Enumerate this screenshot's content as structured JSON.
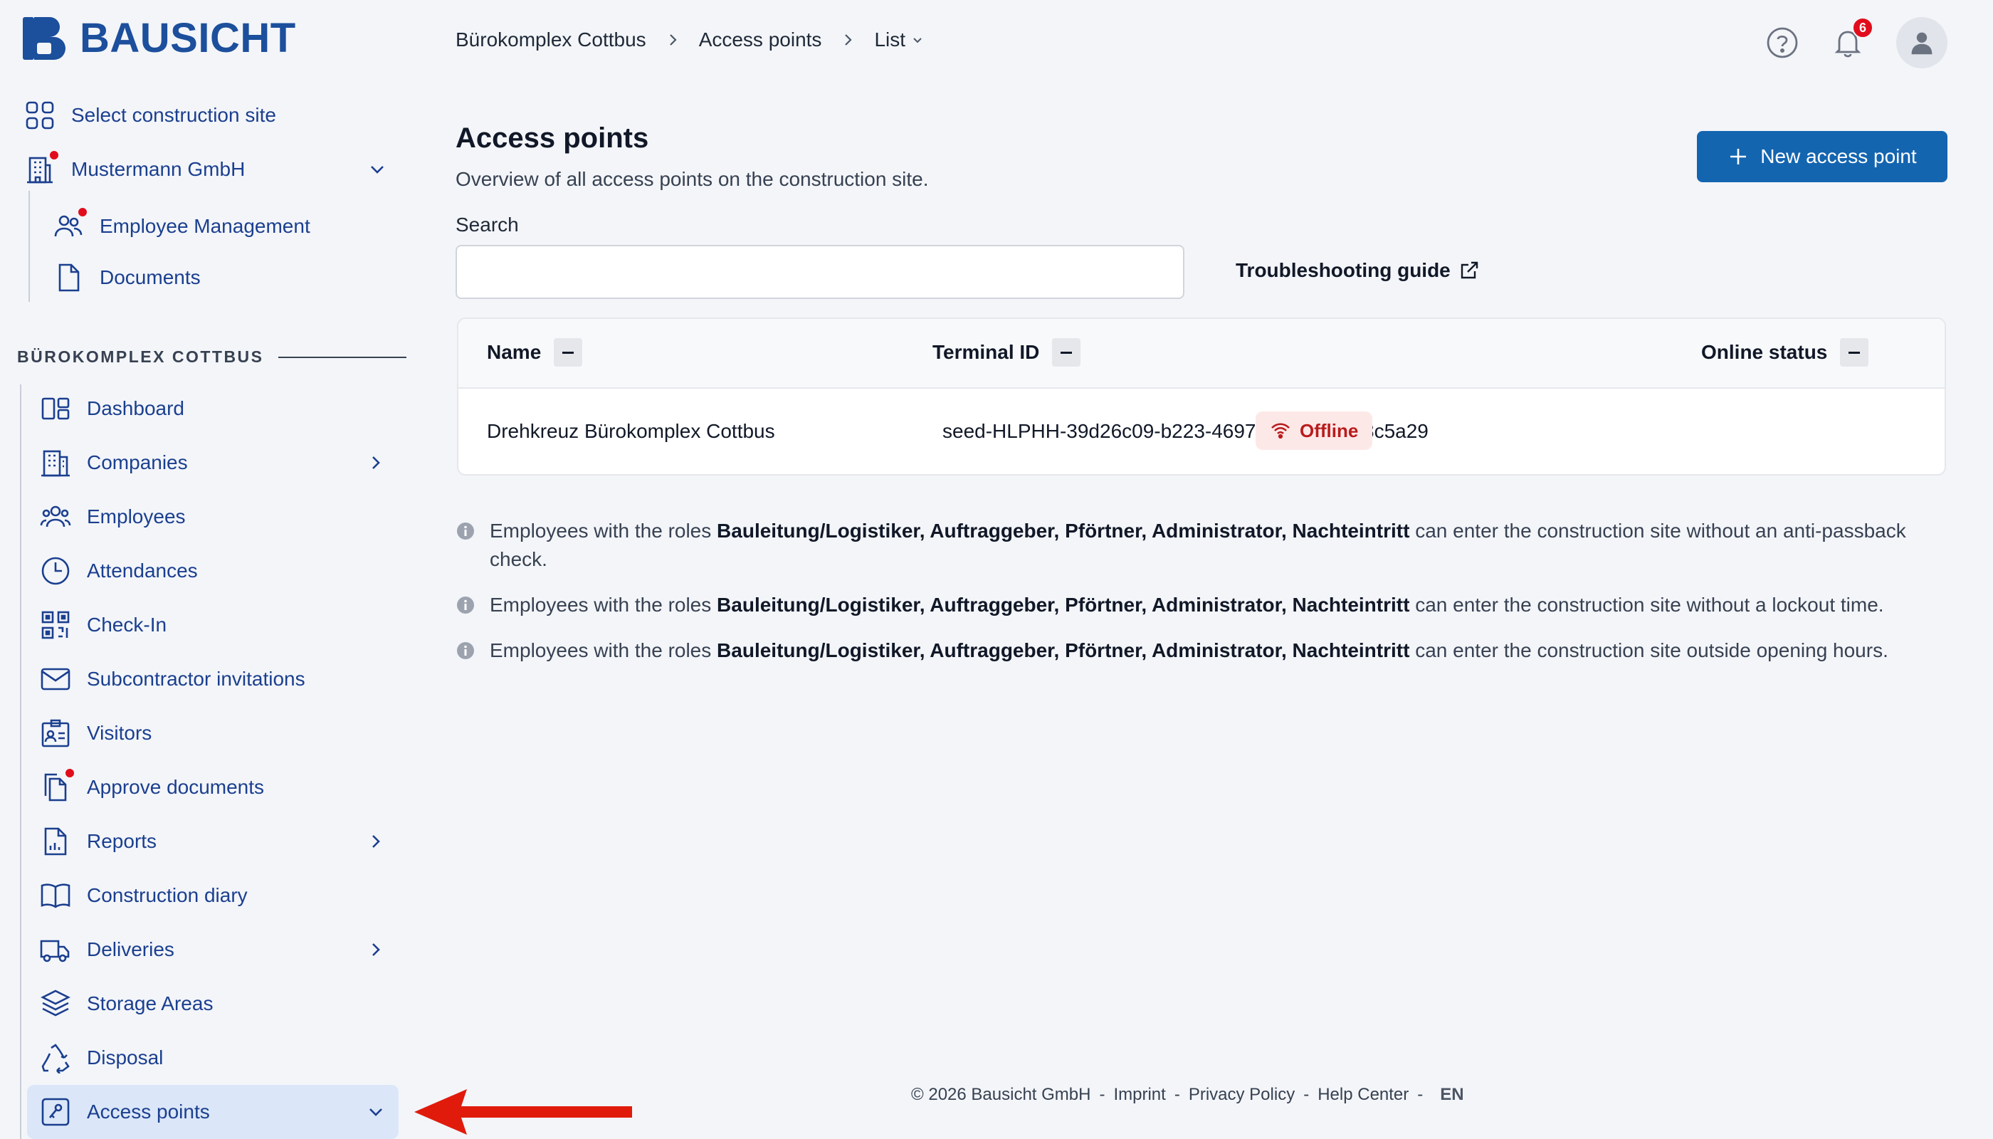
{
  "brand": {
    "name": "BAUSICHT",
    "color": "#1c4f9c"
  },
  "colors": {
    "primary": "#1465b0",
    "nav_text": "#1b3f8f",
    "alert_dot": "#e10d1c",
    "offline_bg": "#fde8e8",
    "offline_text": "#b91c1c",
    "arrow": "#e01b0c"
  },
  "sidebar": {
    "select_site": "Select construction site",
    "company": "Mustermann GmbH",
    "company_items": [
      "Employee Management",
      "Documents"
    ],
    "section_title": "BÜROKOMPLEX COTTBUS",
    "items": [
      {
        "label": "Dashboard",
        "icon": "dashboard-icon"
      },
      {
        "label": "Companies",
        "icon": "building-icon"
      },
      {
        "label": "Employees",
        "icon": "users-icon"
      },
      {
        "label": "Attendances",
        "icon": "clock-icon"
      },
      {
        "label": "Check-In",
        "icon": "qr-code-icon"
      },
      {
        "label": "Subcontractor invitations",
        "icon": "envelope-icon"
      },
      {
        "label": "Visitors",
        "icon": "id-card-icon"
      },
      {
        "label": "Approve documents",
        "icon": "documents-icon"
      },
      {
        "label": "Reports",
        "icon": "report-icon"
      },
      {
        "label": "Construction diary",
        "icon": "book-icon"
      },
      {
        "label": "Deliveries",
        "icon": "truck-icon"
      },
      {
        "label": "Storage Areas",
        "icon": "layers-icon"
      },
      {
        "label": "Disposal",
        "icon": "recycle-icon"
      },
      {
        "label": "Access points",
        "icon": "access-point-icon"
      }
    ]
  },
  "header": {
    "breadcrumb": [
      "Bürokomplex Cottbus",
      "Access points",
      "List"
    ],
    "notification_count": "6"
  },
  "main": {
    "title": "Access points",
    "subtitle": "Overview of all access points on the construction site.",
    "new_button": "New access point",
    "search_label": "Search",
    "search_value": "",
    "troubleshooting": "Troubleshooting guide",
    "table": {
      "columns": [
        "Name",
        "Terminal ID",
        "Online status"
      ],
      "rows": [
        {
          "name": "Drehkreuz Bürokomplex Cottbus",
          "terminal_id": "seed-HLPHH-39d26c09-b223-4697-affd-53f5b48c5a29",
          "status": "Offline"
        }
      ]
    },
    "info": [
      {
        "prefix": "Employees with the roles ",
        "roles": "Bauleitung/Logistiker, Auftraggeber, Pförtner, Administrator, Nachteintritt",
        "suffix": " can enter the construction site without an anti-passback check."
      },
      {
        "prefix": "Employees with the roles ",
        "roles": "Bauleitung/Logistiker, Auftraggeber, Pförtner, Administrator, Nachteintritt",
        "suffix": " can enter the construction site without a lockout time."
      },
      {
        "prefix": "Employees with the roles ",
        "roles": "Bauleitung/Logistiker, Auftraggeber, Pförtner, Administrator, Nachteintritt",
        "suffix": " can enter the construction site outside opening hours."
      }
    ]
  },
  "footer": {
    "copyright": "© 2026 Bausicht GmbH",
    "links": [
      "Imprint",
      "Privacy Policy",
      "Help Center"
    ],
    "language": "EN"
  }
}
